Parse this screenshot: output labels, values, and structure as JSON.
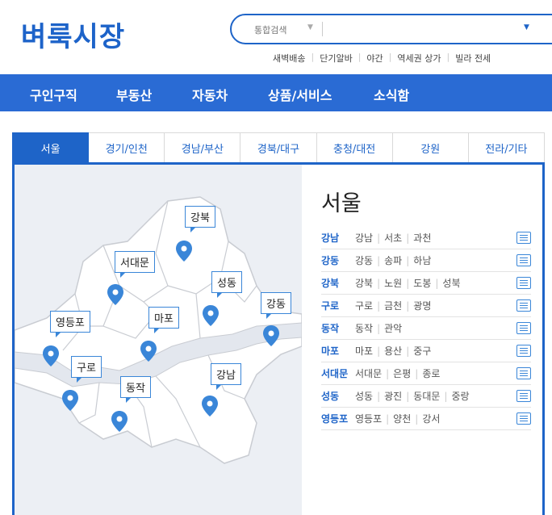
{
  "logo": "벼룩시장",
  "search": {
    "category": "통합검색",
    "placeholder": ""
  },
  "quick_links": [
    "새벽배송",
    "단기알바",
    "야간",
    "역세권 상가",
    "빌라 전세"
  ],
  "gnb": [
    "구인구직",
    "부동산",
    "자동차",
    "상품/서비스",
    "소식함"
  ],
  "tabs": [
    "서울",
    "경기/인천",
    "경남/부산",
    "경북/대구",
    "충청/대전",
    "강원",
    "전라/기타"
  ],
  "active_tab": "서울",
  "map": {
    "pins": [
      "강북",
      "서대문",
      "성동",
      "강동",
      "영등포",
      "마포",
      "구로",
      "동작",
      "강남"
    ]
  },
  "city": "서울",
  "districts": [
    {
      "name": "강남",
      "subs": [
        "강남",
        "서초",
        "과천"
      ]
    },
    {
      "name": "강동",
      "subs": [
        "강동",
        "송파",
        "하남"
      ]
    },
    {
      "name": "강북",
      "subs": [
        "강북",
        "노원",
        "도봉",
        "성북"
      ]
    },
    {
      "name": "구로",
      "subs": [
        "구로",
        "금천",
        "광명"
      ]
    },
    {
      "name": "동작",
      "subs": [
        "동작",
        "관악"
      ]
    },
    {
      "name": "마포",
      "subs": [
        "마포",
        "용산",
        "중구"
      ]
    },
    {
      "name": "서대문",
      "subs": [
        "서대문",
        "은평",
        "종로"
      ]
    },
    {
      "name": "성동",
      "subs": [
        "성동",
        "광진",
        "동대문",
        "중랑"
      ]
    },
    {
      "name": "영등포",
      "subs": [
        "영등포",
        "양천",
        "강서"
      ]
    }
  ],
  "colors": {
    "brand": "#1d63c9",
    "nav": "#2a6bd4",
    "pin": "#3a86d8"
  }
}
